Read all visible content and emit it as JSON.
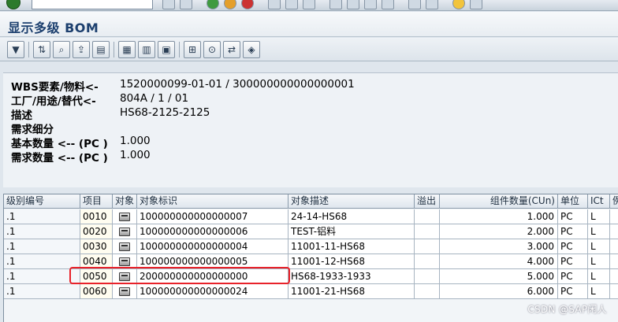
{
  "window": {
    "title": "显示多级 BOM"
  },
  "header": {
    "fields": [
      {
        "label": "WBS要素/物料<-",
        "value": "1520000099-01-01 / 300000000000000001"
      },
      {
        "label": "工厂/用途/替代<-",
        "value": "804A / 1 / 01"
      },
      {
        "label": "描述",
        "value": "HS68-2125-2125"
      },
      {
        "label": "需求细分",
        "value": ""
      },
      {
        "label": "基本数量 <-- (PC )",
        "value": "1.000"
      },
      {
        "label": "需求数量 <-- (PC )",
        "value": "1.000"
      }
    ]
  },
  "table": {
    "columns": [
      "级别编号",
      "项目",
      "对象",
      "对象标识",
      "对象描述",
      "溢出",
      "组件数量(CUn)",
      "单位",
      "ICt",
      "例"
    ],
    "rows": [
      {
        "level": ".1",
        "item": "0010",
        "object": "material-icon",
        "id": "100000000000000007",
        "desc": "24-14-HS68",
        "overflow": "",
        "qty": "1.000",
        "unit": "PC",
        "ict": "L"
      },
      {
        "level": ".1",
        "item": "0020",
        "object": "material-icon",
        "id": "100000000000000006",
        "desc": "TEST-铝料",
        "overflow": "",
        "qty": "2.000",
        "unit": "PC",
        "ict": "L"
      },
      {
        "level": ".1",
        "item": "0030",
        "object": "material-icon",
        "id": "100000000000000004",
        "desc": "11001-11-HS68",
        "overflow": "",
        "qty": "3.000",
        "unit": "PC",
        "ict": "L"
      },
      {
        "level": ".1",
        "item": "0040",
        "object": "material-icon",
        "id": "100000000000000005",
        "desc": "11001-12-HS68",
        "overflow": "",
        "qty": "4.000",
        "unit": "PC",
        "ict": "L"
      },
      {
        "level": ".1",
        "item": "0050",
        "object": "material-icon",
        "id": "200000000000000000",
        "desc": "HS68-1933-1933",
        "overflow": "",
        "qty": "5.000",
        "unit": "PC",
        "ict": "L"
      },
      {
        "level": ".1",
        "item": "0060",
        "object": "material-icon",
        "id": "100000000000000024",
        "desc": "11001-21-HS68",
        "overflow": "",
        "qty": "6.000",
        "unit": "PC",
        "ict": "L"
      }
    ]
  },
  "watermark": "CSDN @SAP闲人",
  "colors": {
    "highlight": "#e8222a",
    "title": "#1c3f6e"
  }
}
